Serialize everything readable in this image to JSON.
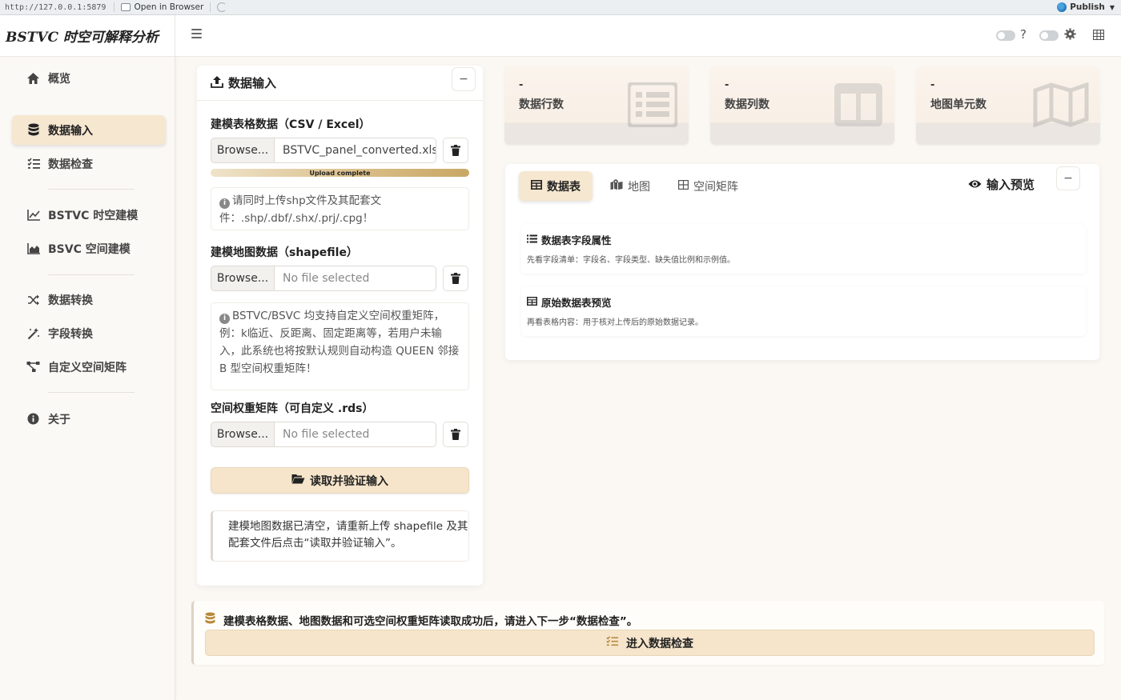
{
  "browser": {
    "url": "http://127.0.0.1:5879",
    "open_in_browser": "Open in Browser",
    "publish": "Publish"
  },
  "app": {
    "title": "BSTVC 时空可解释分析"
  },
  "sidebar": {
    "items": [
      {
        "label": "概览",
        "icon": "home-icon"
      },
      {
        "label": "数据输入",
        "icon": "database-icon",
        "active": true
      },
      {
        "label": "数据检查",
        "icon": "checklist-icon"
      },
      {
        "label": "BSTVC 时空建模",
        "icon": "line-chart-icon"
      },
      {
        "label": "BSVC 空间建模",
        "icon": "area-chart-icon"
      },
      {
        "label": "数据转换",
        "icon": "shuffle-icon"
      },
      {
        "label": "字段转换",
        "icon": "magic-wand-icon"
      },
      {
        "label": "自定义空间矩阵",
        "icon": "network-icon"
      },
      {
        "label": "关于",
        "icon": "info-icon"
      }
    ]
  },
  "input_card": {
    "title": "数据输入",
    "collapse_symbol": "−",
    "table_field": {
      "label": "建模表格数据（CSV / Excel）",
      "browse": "Browse...",
      "file": "BSTVC_panel_converted.xlsx",
      "progress_text": "Upload complete",
      "progress": 1.0
    },
    "shp_note": "请同时上传shp文件及其配套文件：.shp/.dbf/.shx/.prj/.cpg！",
    "map_field": {
      "label": "建模地图数据（shapefile）",
      "browse": "Browse...",
      "file": "No file selected"
    },
    "matrix_note": "BSTVC/BSVC 均支持自定义空间权重矩阵，例：k临近、反距离、固定距离等，若用户未输入，此系统也将按默认规则自动构造 QUEEN 邻接 B 型空间权重矩阵！",
    "matrix_field": {
      "label": "空间权重矩阵（可自定义 .rds）",
      "browse": "Browse...",
      "file": "No file selected"
    },
    "read_button": "读取并验证输入",
    "status": "建模地图数据已清空，请重新上传 shapefile 及其配套文件后点击“读取并验证输入”。"
  },
  "stats": [
    {
      "value": "-",
      "label": "数据行数",
      "icon": "list-icon"
    },
    {
      "value": "-",
      "label": "数据列数",
      "icon": "columns-icon"
    },
    {
      "value": "-",
      "label": "地图单元数",
      "icon": "map-icon"
    }
  ],
  "preview": {
    "tabs": [
      {
        "label": "数据表",
        "icon": "table-icon",
        "active": true
      },
      {
        "label": "地图",
        "icon": "map-marker-icon"
      },
      {
        "label": "空间矩阵",
        "icon": "grid-icon"
      }
    ],
    "title": "输入预览",
    "collapse_symbol": "−",
    "sections": [
      {
        "title": "数据表字段属性",
        "desc": "先看字段清单：字段名、字段类型、缺失值比例和示例值。"
      },
      {
        "title": "原始数据表预览",
        "desc": "再看表格内容：用于核对上传后的原始数据记录。"
      }
    ]
  },
  "banner": {
    "message": "建模表格数据、地图数据和可选空间权重矩阵读取成功后，请进入下一步“数据检查”。",
    "button": "进入数据检查"
  }
}
